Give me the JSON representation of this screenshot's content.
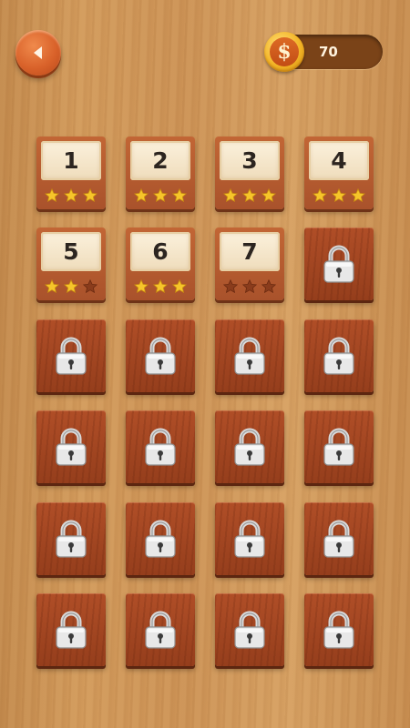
{
  "header": {
    "back_icon": "back-arrow-icon",
    "coin_icon": "dollar-coin-icon",
    "coin_symbol": "$",
    "coins": "70"
  },
  "levels": [
    {
      "label": "1",
      "stars": 3,
      "locked": false
    },
    {
      "label": "2",
      "stars": 3,
      "locked": false
    },
    {
      "label": "3",
      "stars": 3,
      "locked": false
    },
    {
      "label": "4",
      "stars": 3,
      "locked": false
    },
    {
      "label": "5",
      "stars": 2,
      "locked": false
    },
    {
      "label": "6",
      "stars": 3,
      "locked": false
    },
    {
      "label": "7",
      "stars": 0,
      "locked": false
    },
    {
      "locked": true
    },
    {
      "locked": true
    },
    {
      "locked": true
    },
    {
      "locked": true
    },
    {
      "locked": true
    },
    {
      "locked": true
    },
    {
      "locked": true
    },
    {
      "locked": true
    },
    {
      "locked": true
    },
    {
      "locked": true
    },
    {
      "locked": true
    },
    {
      "locked": true
    },
    {
      "locked": true
    },
    {
      "locked": true
    },
    {
      "locked": true
    },
    {
      "locked": true
    },
    {
      "locked": true
    }
  ],
  "colors": {
    "star_filled": "#f6c52a",
    "star_empty": "#8a3c1c",
    "tile_wood": "#a9522b",
    "lock_body": "#e8e8e8"
  }
}
